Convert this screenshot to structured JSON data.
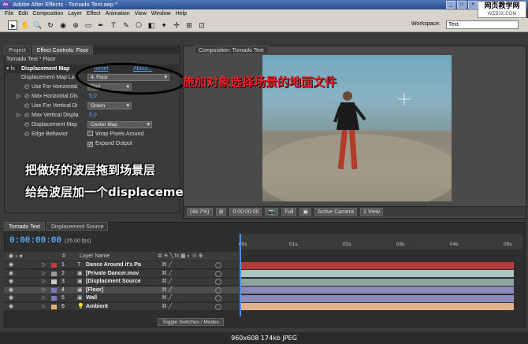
{
  "window": {
    "title": "Adobe After Effects - Tornado Text.aep *",
    "app_icon": "Ae"
  },
  "watermark": {
    "line1": "网页教学网",
    "line2": "WEB3X.COM"
  },
  "menu": [
    "File",
    "Edit",
    "Composition",
    "Layer",
    "Effect",
    "Animation",
    "View",
    "Window",
    "Help"
  ],
  "workspace": {
    "label": "Workspace:",
    "value": "Text"
  },
  "left_panel": {
    "tabs": [
      "Project",
      "Effect Controls: Floor"
    ],
    "subtitle": "Tornado Text * Floor",
    "effect_name": "Displacement Map",
    "reset": "Reset",
    "about": "About...",
    "params": [
      {
        "label": "Displacement Map La",
        "value": "4. Floor"
      },
      {
        "label": "Use For Horizontal",
        "value": "Red"
      },
      {
        "label": "Max Horizontal Dis",
        "value": "5.0"
      },
      {
        "label": "Use For Vertical Di",
        "value": "Green"
      },
      {
        "label": "Max Vertical Displa",
        "value": "5.0"
      },
      {
        "label": "Displacement Map",
        "value": "Center Map"
      },
      {
        "label": "Edge Behavior",
        "value": "Wrap Pixels Around"
      },
      {
        "label": "",
        "value": "Expand Output"
      }
    ]
  },
  "captions": {
    "red": "施加对象选择场景的地面文件",
    "white1": "把做好的波层拖到场景层",
    "white2": "给给波层加一个displacement map效果"
  },
  "composition": {
    "tab": "Composition: Tornado Text",
    "zoom": "(46.7%)",
    "timecode": "0:00:00:00",
    "resolution": "Full",
    "camera": "Active Camera",
    "view": "1 View"
  },
  "timeline": {
    "tabs": [
      "Tornado Text",
      "Displacement Source"
    ],
    "timecode": "0:00:00:00",
    "fps": "(25.00 fps)",
    "ruler": [
      "00s",
      "01s",
      "02s",
      "03s",
      "04s",
      "05s"
    ],
    "header": {
      "num": "#",
      "name": "Layer Name"
    },
    "layers": [
      {
        "num": "1",
        "type": "T",
        "name": "Dance Around it's Pa",
        "color": "#c23b3b",
        "bar": "#b83a3a"
      },
      {
        "num": "2",
        "type": "▣",
        "name": "[Private Dancer.mov",
        "color": "#9c9c9c",
        "bar": "#a9c7c2"
      },
      {
        "num": "3",
        "type": "▣",
        "name": "[Displacment Source",
        "color": "#c9c9c9",
        "bar": "#8fa3a0"
      },
      {
        "num": "4",
        "type": "▣",
        "name": "[Floor]",
        "color": "#7a7ab8",
        "bar": "#8a8ab9"
      },
      {
        "num": "5",
        "type": "▣",
        "name": "Wall",
        "color": "#7a7ab8",
        "bar": "#8c8cba"
      },
      {
        "num": "6",
        "type": "💡",
        "name": "Ambient",
        "color": "#e8b070",
        "bar": "#e1b38a"
      }
    ],
    "toggle": "Toggle Switches / Modes"
  },
  "status": "960x608  174kb  JPEG"
}
